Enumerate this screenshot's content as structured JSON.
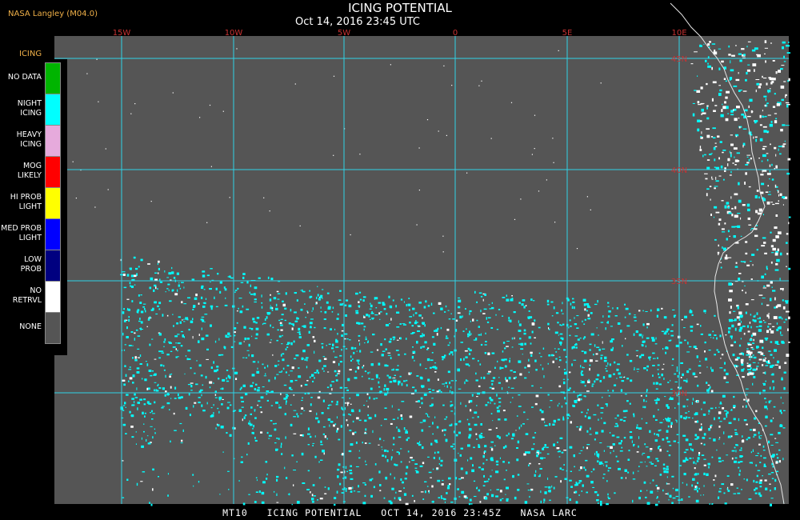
{
  "header": {
    "source": "NASA Langley (M04.0)",
    "title": "ICING POTENTIAL",
    "subtitle": "Oct 14, 2016 23:45 UTC"
  },
  "legend": {
    "title": "ICING",
    "items": [
      {
        "label": "NO DATA",
        "color": "#00b400"
      },
      {
        "label": "NIGHT\nICING",
        "color": "#00ffff"
      },
      {
        "label": "HEAVY\nICING",
        "color": "#e6aadc"
      },
      {
        "label": "MOG\nLIKELY",
        "color": "#ff0000"
      },
      {
        "label": "HI PROB\nLIGHT",
        "color": "#ffff00"
      },
      {
        "label": "MED PROB\nLIGHT",
        "color": "#0000ff"
      },
      {
        "label": "LOW\nPROB",
        "color": "#000080"
      },
      {
        "label": "NO\nRETRVL",
        "color": "#ffffff"
      },
      {
        "label": "NONE",
        "color": "#555555"
      }
    ]
  },
  "map": {
    "background": "#555555",
    "grid_color": "#30d2e6",
    "icing_color": "#00ffff",
    "lon_labels": [
      "15W",
      "10W",
      "5W",
      "0",
      "5E",
      "10E"
    ],
    "lat_labels": [
      "45N",
      "40N",
      "35N",
      "30N"
    ]
  },
  "footer": "MT10   ICING POTENTIAL   OCT 14, 2016 23:45Z   NASA LARC"
}
